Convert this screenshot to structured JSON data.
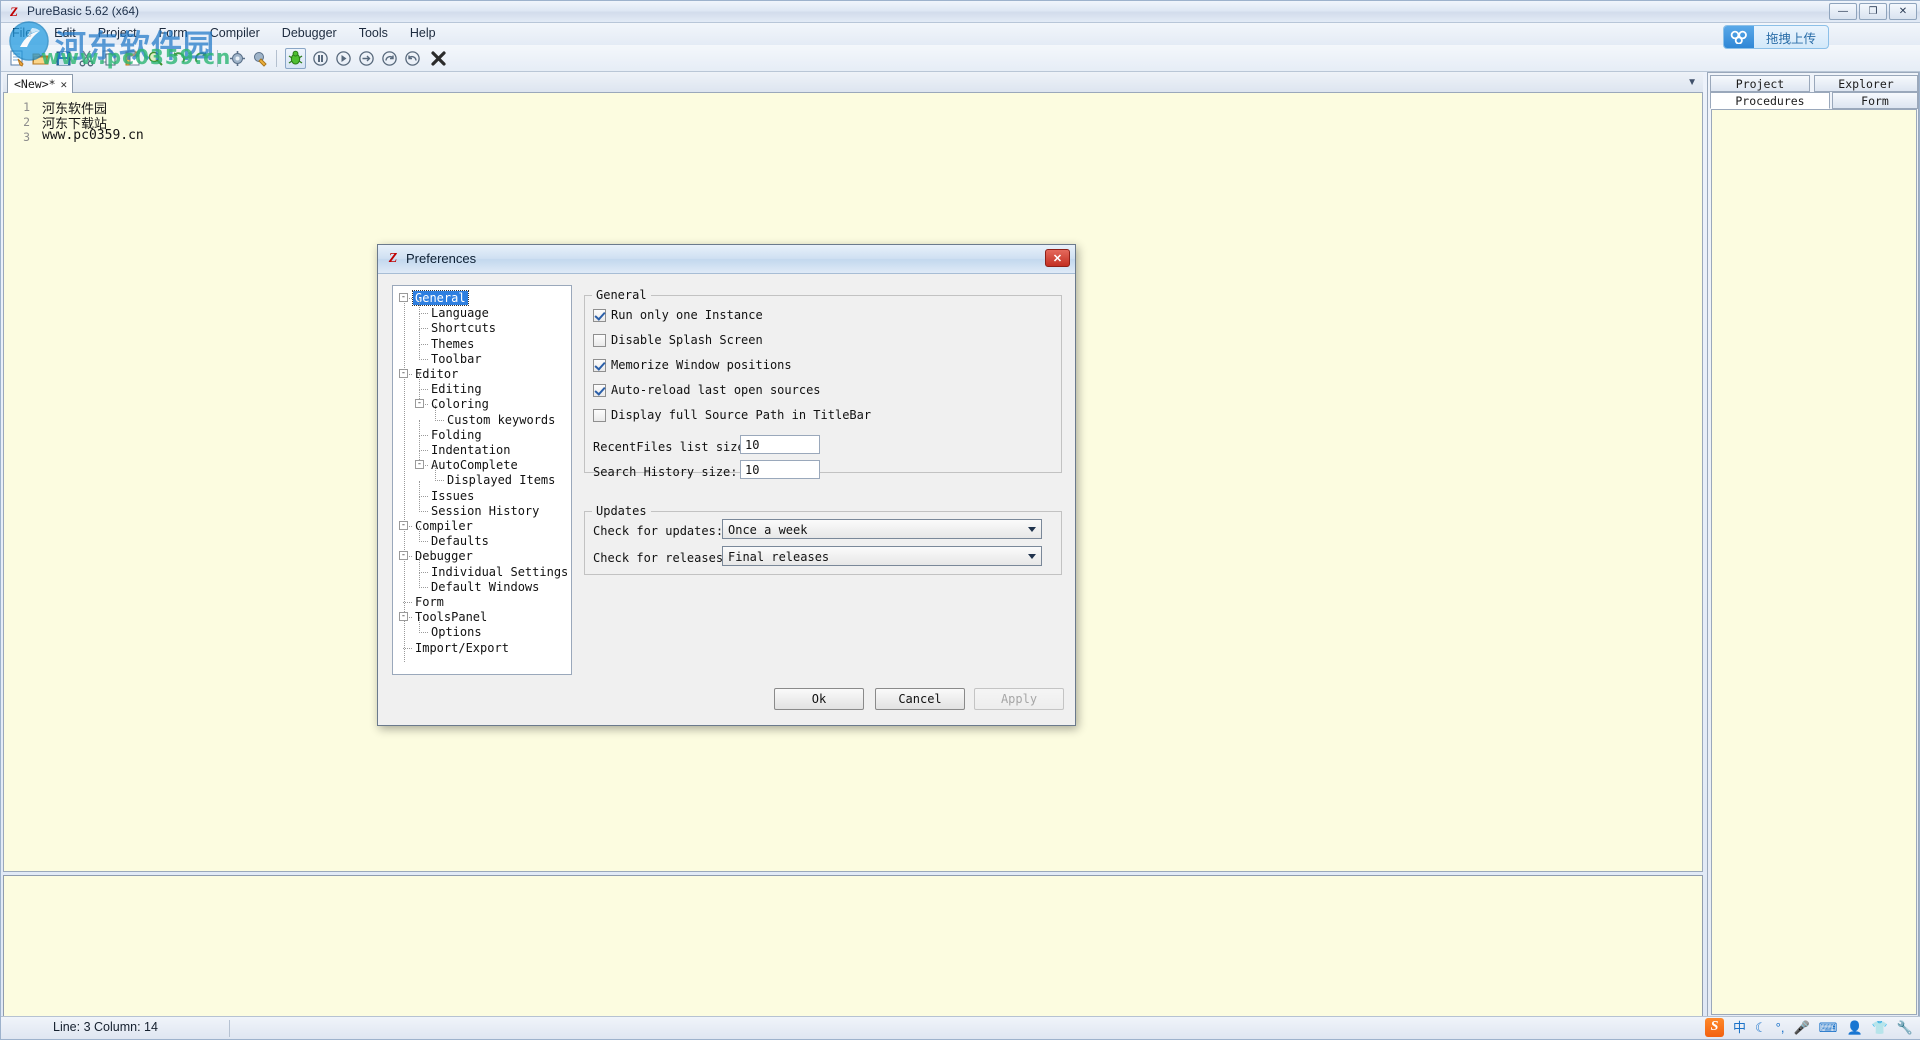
{
  "window": {
    "title": "PureBasic 5.62 (x64)",
    "app_icon": "purebasic-logo-icon",
    "controls": {
      "minimize": "—",
      "restore": "❐",
      "close": "✕"
    }
  },
  "menubar": {
    "items": [
      {
        "label": "File"
      },
      {
        "label": "Edit"
      },
      {
        "label": "Project"
      },
      {
        "label": "Form"
      },
      {
        "label": "Compiler"
      },
      {
        "label": "Debugger"
      },
      {
        "label": "Tools"
      },
      {
        "label": "Help"
      }
    ]
  },
  "toolbar": {
    "buttons": [
      {
        "name": "new-file-icon"
      },
      {
        "name": "open-file-icon"
      },
      {
        "name": "save-file-icon"
      },
      {
        "name": "cut-icon"
      },
      {
        "name": "copy-icon"
      },
      {
        "name": "paste-icon"
      },
      {
        "name": "find-icon"
      },
      {
        "name": "undo-icon"
      },
      {
        "name": "redo-icon"
      },
      {
        "name": "compiler-options-icon"
      },
      {
        "name": "build-icon"
      },
      {
        "name": "run-debug-icon"
      },
      {
        "name": "pause-icon"
      },
      {
        "name": "continue-icon"
      },
      {
        "name": "step-over-icon"
      },
      {
        "name": "step-into-icon"
      },
      {
        "name": "step-out-icon"
      },
      {
        "name": "stop-icon"
      }
    ]
  },
  "upload_widget": {
    "label": "拖拽上传",
    "icon": "cloud-upload-icon"
  },
  "watermark": {
    "text": "河东软件园",
    "url": "www.pc0359.cn"
  },
  "editor": {
    "tab": {
      "label": "<New>*",
      "close": "✕"
    },
    "collapse_arrow": "▼",
    "lines": [
      {
        "num": "1",
        "text": "河东软件园"
      },
      {
        "num": "2",
        "text": "河东下载站"
      },
      {
        "num": "3",
        "text": "www.pc0359.cn"
      }
    ]
  },
  "sidepanel": {
    "tabs_top": [
      {
        "label": "Project",
        "selected": false
      },
      {
        "label": "Explorer",
        "selected": false
      }
    ],
    "tabs_bottom": [
      {
        "label": "Procedures",
        "selected": true
      },
      {
        "label": "Form",
        "selected": false
      }
    ]
  },
  "statusbar": {
    "position": "Line: 3   Column: 14"
  },
  "ime": {
    "logo": "sogou-logo-icon",
    "items": [
      {
        "name": "chinese-mode-icon",
        "glyph": "中"
      },
      {
        "name": "moon-icon",
        "glyph": "☾"
      },
      {
        "name": "punctuation-icon",
        "glyph": "°,"
      },
      {
        "name": "voice-input-icon",
        "glyph": "🎤"
      },
      {
        "name": "soft-keyboard-icon",
        "glyph": "⌨"
      },
      {
        "name": "user-icon",
        "glyph": "👤"
      },
      {
        "name": "skin-icon",
        "glyph": "👕"
      },
      {
        "name": "toolbox-icon",
        "glyph": "🔧"
      }
    ]
  },
  "prefs_dialog": {
    "title": "Preferences",
    "icon": "purebasic-logo-icon",
    "close_label": "✕",
    "tree": [
      {
        "label": "General",
        "depth": 0,
        "expander": "-",
        "selected": true
      },
      {
        "label": "Language",
        "depth": 1,
        "expander": "",
        "selected": false
      },
      {
        "label": "Shortcuts",
        "depth": 1,
        "expander": "",
        "selected": false
      },
      {
        "label": "Themes",
        "depth": 1,
        "expander": "",
        "selected": false
      },
      {
        "label": "Toolbar",
        "depth": 1,
        "expander": "",
        "selected": false
      },
      {
        "label": "Editor",
        "depth": 0,
        "expander": "-",
        "selected": false
      },
      {
        "label": "Editing",
        "depth": 1,
        "expander": "",
        "selected": false
      },
      {
        "label": "Coloring",
        "depth": 1,
        "expander": "-",
        "selected": false
      },
      {
        "label": "Custom keywords",
        "depth": 2,
        "expander": "",
        "selected": false
      },
      {
        "label": "Folding",
        "depth": 1,
        "expander": "",
        "selected": false
      },
      {
        "label": "Indentation",
        "depth": 1,
        "expander": "",
        "selected": false
      },
      {
        "label": "AutoComplete",
        "depth": 1,
        "expander": "-",
        "selected": false
      },
      {
        "label": "Displayed Items",
        "depth": 2,
        "expander": "",
        "selected": false
      },
      {
        "label": "Issues",
        "depth": 1,
        "expander": "",
        "selected": false
      },
      {
        "label": "Session History",
        "depth": 1,
        "expander": "",
        "selected": false
      },
      {
        "label": "Compiler",
        "depth": 0,
        "expander": "-",
        "selected": false
      },
      {
        "label": "Defaults",
        "depth": 1,
        "expander": "",
        "selected": false
      },
      {
        "label": "Debugger",
        "depth": 0,
        "expander": "-",
        "selected": false
      },
      {
        "label": "Individual Settings",
        "depth": 1,
        "expander": "",
        "selected": false
      },
      {
        "label": "Default Windows",
        "depth": 1,
        "expander": "",
        "selected": false
      },
      {
        "label": "Form",
        "depth": 0,
        "expander": "",
        "selected": false
      },
      {
        "label": "ToolsPanel",
        "depth": 0,
        "expander": "-",
        "selected": false
      },
      {
        "label": "Options",
        "depth": 1,
        "expander": "",
        "selected": false
      },
      {
        "label": "Import/Export",
        "depth": 0,
        "expander": "",
        "selected": false
      }
    ],
    "general_group": {
      "title": "General",
      "checkboxes": [
        {
          "label": "Run only one Instance",
          "checked": true
        },
        {
          "label": "Disable Splash Screen",
          "checked": false
        },
        {
          "label": "Memorize Window positions",
          "checked": true
        },
        {
          "label": "Auto-reload last open sources",
          "checked": true
        },
        {
          "label": "Display full Source Path in TitleBar",
          "checked": false
        }
      ],
      "fields": [
        {
          "label": "RecentFiles list size:",
          "value": "10"
        },
        {
          "label": "Search History size:",
          "value": "10"
        }
      ]
    },
    "updates_group": {
      "title": "Updates",
      "fields": [
        {
          "label": "Check for updates:",
          "value": "Once a week"
        },
        {
          "label": "Check for releases:",
          "value": "Final releases"
        }
      ]
    },
    "buttons": {
      "ok": "Ok",
      "cancel": "Cancel",
      "apply": "Apply"
    }
  }
}
